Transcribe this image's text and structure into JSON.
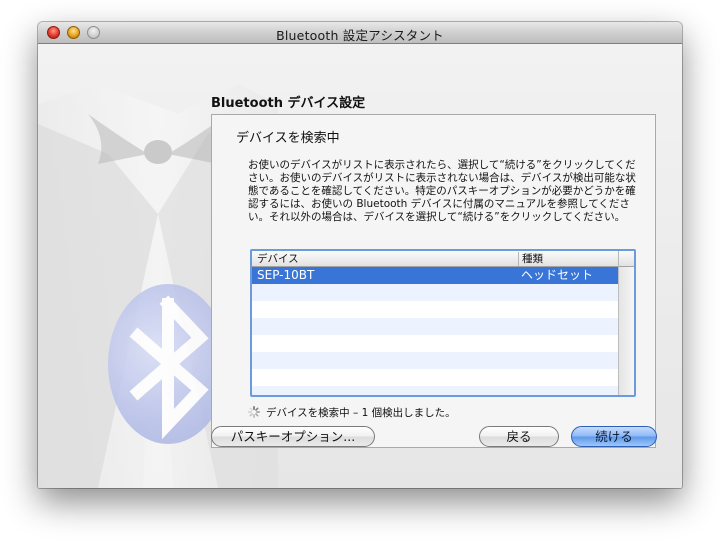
{
  "window": {
    "title": "Bluetooth 設定アシスタント"
  },
  "page": {
    "heading": "Bluetooth デバイス設定"
  },
  "panel": {
    "title": "デバイスを検索中",
    "instructions": "お使いのデバイスがリストに表示されたら、選択して“続ける”をクリックしてください。お使いのデバイスがリストに表示されない場合は、デバイスが検出可能な状態であることを確認してください。特定のパスキーオプションが必要かどうかを確認するには、お使いの Bluetooth デバイスに付属のマニュアルを参照してください。それ以外の場合は、デバイスを選択して“続ける”をクリックしてください。"
  },
  "device_table": {
    "columns": [
      "デバイス",
      "種類"
    ],
    "rows": [
      {
        "name": "SEP-10BT",
        "type": "ヘッドセット",
        "selected": true
      }
    ],
    "empty_rows": 7
  },
  "status": {
    "text": "デバイスを検索中 – 1 個検出しました。"
  },
  "buttons": {
    "passkey_options": "パスキーオプション...",
    "back": "戻る",
    "continue": "続ける"
  },
  "icons": {
    "close": "close-icon",
    "minimize": "minimize-icon",
    "zoom": "zoom-icon",
    "spinner": "spinner-icon",
    "bluetooth": "bluetooth-icon"
  },
  "colors": {
    "selection": "#3875d7",
    "table_border": "#6b9bdc",
    "alt_row": "#edf3fe",
    "default_button": "#5f99ea"
  }
}
